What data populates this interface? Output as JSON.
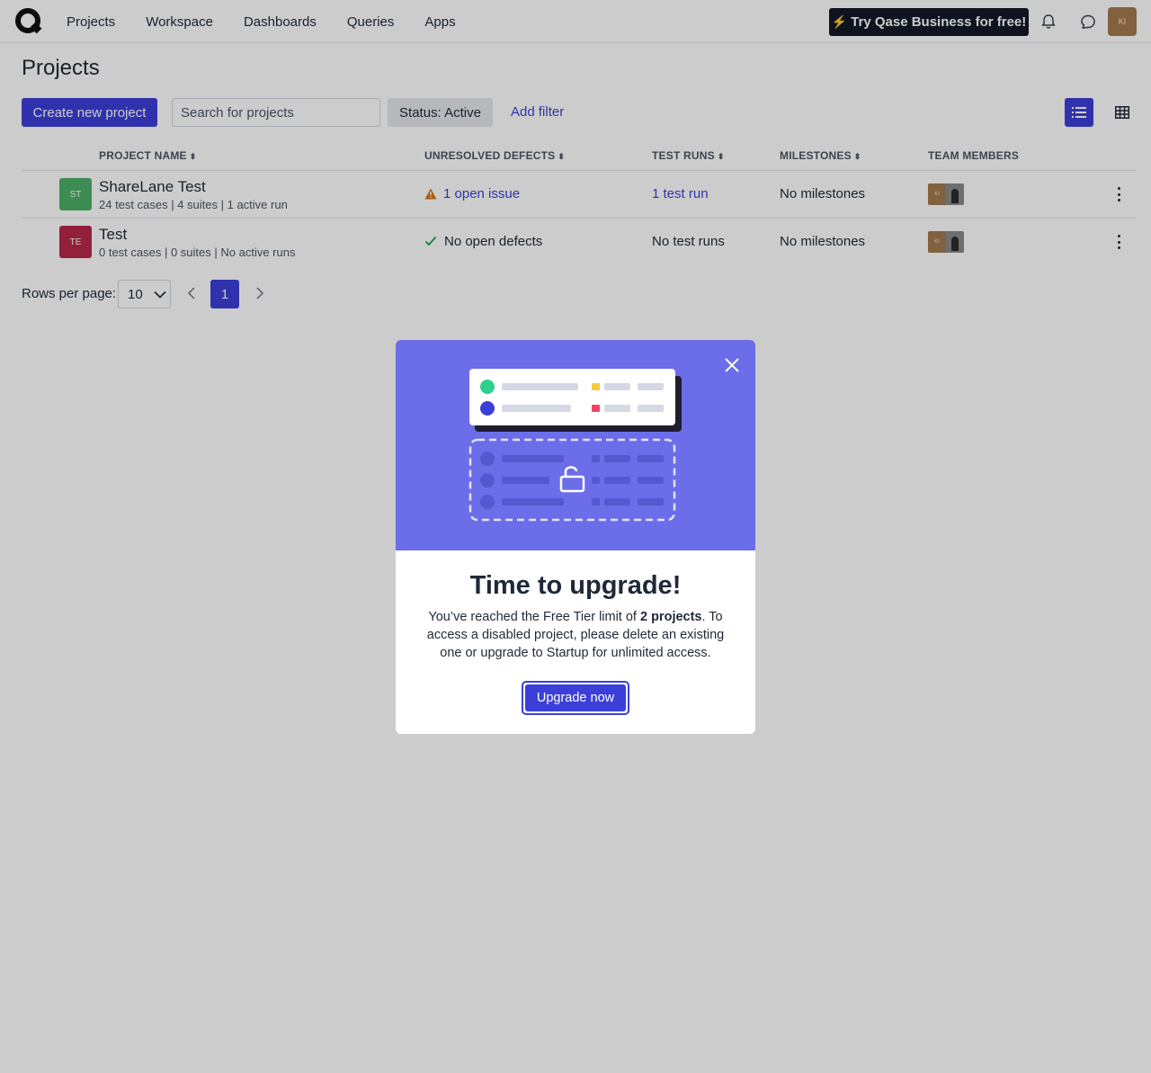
{
  "nav": {
    "links": [
      "Projects",
      "Workspace",
      "Dashboards",
      "Queries",
      "Apps"
    ],
    "try_business": "Try Qase Business for free!",
    "avatar_initials": "KI"
  },
  "page": {
    "title": "Projects",
    "create_button": "Create new project",
    "search_placeholder": "Search for projects",
    "status_filter": "Status: Active",
    "add_filter": "Add filter"
  },
  "table": {
    "headers": {
      "project_name": "PROJECT NAME",
      "unresolved_defects": "UNRESOLVED DEFECTS",
      "test_runs": "TEST RUNS",
      "milestones": "MILESTONES",
      "team_members": "TEAM MEMBERS"
    },
    "rows": [
      {
        "initials": "ST",
        "avatar_color": "#4caf68",
        "name": "ShareLane Test",
        "meta": "24 test cases | 4 suites | 1 active run",
        "defects": "1 open issue",
        "test_runs": "1 test run",
        "milestones": "No milestones",
        "member_initials": "KI"
      },
      {
        "initials": "TE",
        "avatar_color": "#b7284a",
        "name": "Test",
        "meta": "0 test cases | 0 suites | No active runs",
        "defects": "No open defects",
        "test_runs": "No test runs",
        "milestones": "No milestones",
        "member_initials": "KI"
      }
    ]
  },
  "pagination": {
    "rows_label": "Rows per page:",
    "rows_value": "10",
    "current_page": "1"
  },
  "modal": {
    "title": "Time to upgrade!",
    "text_before": "You’ve reached the Free Tier limit of ",
    "text_bold": "2 projects",
    "text_after": ". To access a disabled project, please delete an existing one or upgrade to Startup for unlimited access.",
    "button": "Upgrade now"
  },
  "colors": {
    "accent": "#3b3fd8",
    "hero": "#6b6ee8",
    "warning": "#d97706",
    "success": "#16a34a"
  }
}
